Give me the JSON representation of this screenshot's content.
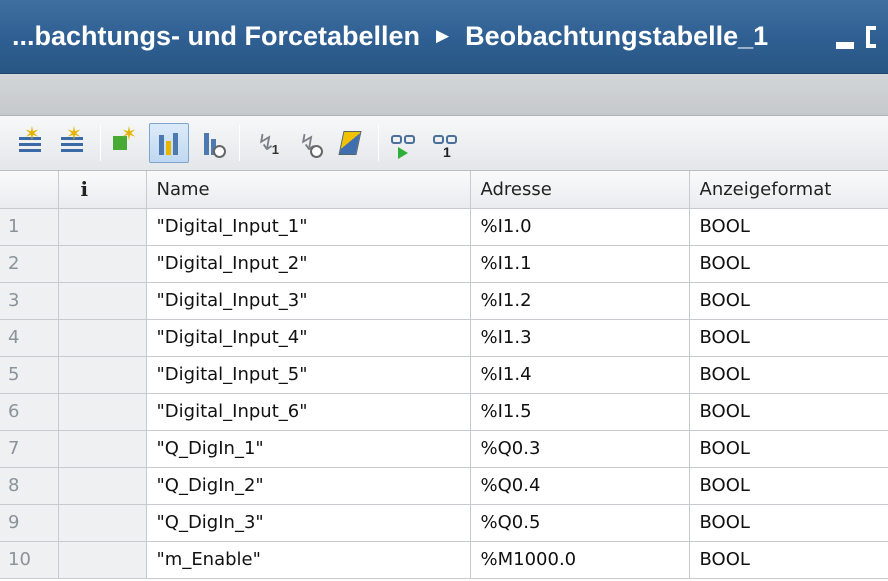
{
  "title_bar": {
    "breadcrumb_parent": "...bachtungs- und Forcetabellen",
    "breadcrumb_current": "Beobachtungstabelle_1"
  },
  "toolbar": {
    "buttons": [
      {
        "icon": "insert-row-icon"
      },
      {
        "icon": "add-row-icon"
      },
      {
        "icon": "multi-row-icon"
      },
      {
        "icon": "force-mode-icon",
        "active": true
      },
      {
        "icon": "trigger-icon"
      },
      {
        "icon": "modify-once-icon",
        "sub": "1"
      },
      {
        "icon": "modify-trigger-icon"
      },
      {
        "icon": "force-all-icon"
      },
      {
        "icon": "monitor-all-icon"
      },
      {
        "icon": "monitor-once-icon",
        "sub": "1"
      }
    ]
  },
  "table": {
    "columns": [
      "",
      "i",
      "Name",
      "Adresse",
      "Anzeigeformat"
    ],
    "rows": [
      {
        "num": "1",
        "name": "\"Digital_Input_1\"",
        "address": "%I1.0",
        "format": "BOOL"
      },
      {
        "num": "2",
        "name": "\"Digital_Input_2\"",
        "address": "%I1.1",
        "format": "BOOL"
      },
      {
        "num": "3",
        "name": "\"Digital_Input_3\"",
        "address": "%I1.2",
        "format": "BOOL"
      },
      {
        "num": "4",
        "name": "\"Digital_Input_4\"",
        "address": "%I1.3",
        "format": "BOOL"
      },
      {
        "num": "5",
        "name": "\"Digital_Input_5\"",
        "address": "%I1.4",
        "format": "BOOL"
      },
      {
        "num": "6",
        "name": "\"Digital_Input_6\"",
        "address": "%I1.5",
        "format": "BOOL"
      },
      {
        "num": "7",
        "name": "\"Q_DigIn_1\"",
        "address": "%Q0.3",
        "format": "BOOL"
      },
      {
        "num": "8",
        "name": "\"Q_DigIn_2\"",
        "address": "%Q0.4",
        "format": "BOOL"
      },
      {
        "num": "9",
        "name": "\"Q_DigIn_3\"",
        "address": "%Q0.5",
        "format": "BOOL"
      },
      {
        "num": "10",
        "name": "\"m_Enable\"",
        "address": "%M1000.0",
        "format": "BOOL"
      }
    ]
  },
  "colors": {
    "title_bg": "#2f5f92",
    "title_text": "#ffffff",
    "toolbar_bg": "#eef0f2",
    "grid_line": "#c7cbd0",
    "row_number_text": "#8b929a"
  }
}
